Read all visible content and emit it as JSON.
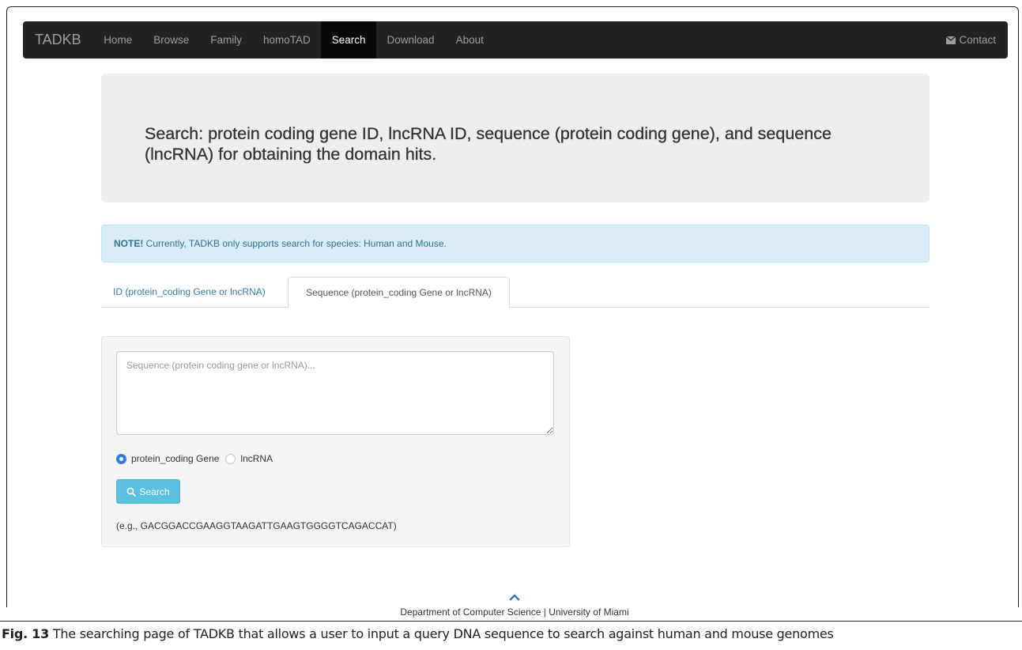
{
  "navbar": {
    "brand": "TADKB",
    "items": [
      "Home",
      "Browse",
      "Family",
      "homoTAD",
      "Search",
      "Download",
      "About"
    ],
    "active": "Search",
    "contact_label": "Contact"
  },
  "jumbotron": {
    "heading": "Search: protein coding gene ID, lncRNA ID, sequence (protein coding gene), and sequence (lncRNA) for obtaining the domain hits."
  },
  "alert": {
    "strong": "NOTE!",
    "text": " Currently, TADKB only supports search for species: Human and Mouse."
  },
  "tabs": {
    "id_tab": "ID (protein_coding Gene or lncRNA)",
    "seq_tab": "Sequence (protein_coding Gene or lncRNA)"
  },
  "form": {
    "placeholder": "Sequence (protein coding gene or lncRNA)...",
    "value": "",
    "radio_protein": "protein_coding Gene",
    "radio_lncrna": "lncRNA",
    "selected": "protein_coding Gene",
    "search_label": "Search",
    "example": "(e.g., GACGGACCGAAGGTAAGATTGAAGTGGGGTCAGACCAT)"
  },
  "footer": {
    "text": "Department of Computer Science | University of Miami"
  },
  "caption": {
    "label": "Fig. 13",
    "text": " The searching page of TADKB that allows a user to input a query DNA sequence to search against human and mouse genomes"
  },
  "colors": {
    "navbar_bg": "#222222",
    "link": "#337ab7",
    "alert_bg": "#d9edf7",
    "button_info": "#5bc0de",
    "radio_selected": "#2f7ce0"
  }
}
